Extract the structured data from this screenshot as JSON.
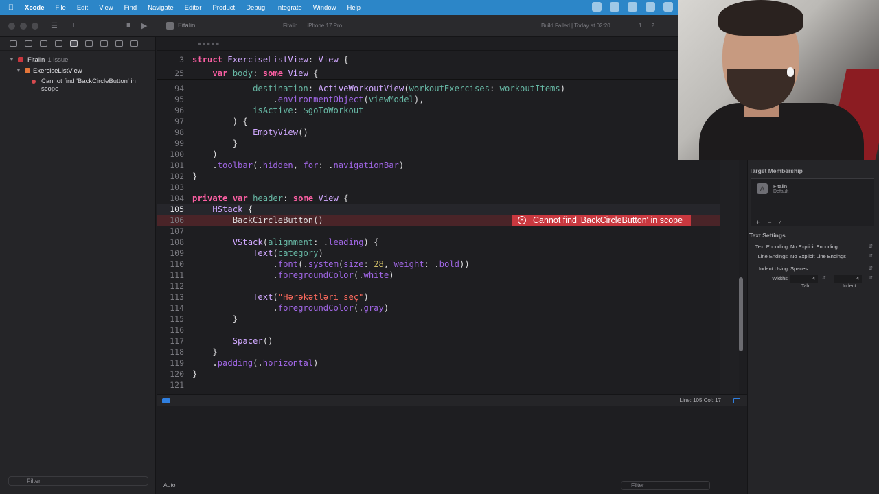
{
  "menubar": {
    "app_name": "Xcode",
    "items": [
      "File",
      "Edit",
      "View",
      "Find",
      "Navigate",
      "Editor",
      "Product",
      "Debug",
      "Integrate",
      "Window",
      "Help"
    ]
  },
  "toolbar": {
    "project": "Fitalin",
    "scheme": "Fitalin",
    "device": "iPhone 17 Pro",
    "build_status": "Build Failed | Today at 02:20",
    "error_count": "1",
    "warning_count": "2"
  },
  "navigator": {
    "project_name": "Fitalin",
    "project_issue_count": "1 issue",
    "file_name": "ExerciseListView",
    "issue_text": "Cannot find 'BackCircleButton' in scope",
    "filter_placeholder": "Filter"
  },
  "editor": {
    "sticky": [
      {
        "num": "3",
        "text": "struct ExerciseListView: View {"
      },
      {
        "num": "25",
        "text": "var body: some View {"
      }
    ],
    "error_message": "Cannot find 'BackCircleButton' in scope",
    "cursor": "Line: 105  Col: 17",
    "console_mode": "Auto",
    "console_filter_placeholder": "Filter"
  },
  "inspector": {
    "target_membership_title": "Target Membership",
    "target_name": "Fitalin",
    "target_sub": "Default",
    "text_settings_title": "Text Settings",
    "text_encoding_label": "Text Encoding",
    "text_encoding_value": "No Explicit Encoding",
    "line_endings_label": "Line Endings",
    "line_endings_value": "No Explicit Line Endings",
    "indent_using_label": "Indent Using",
    "indent_using_value": "Spaces",
    "widths_label": "Widths",
    "tab_width": "4",
    "indent_width": "4",
    "tab_label": "Tab",
    "indent_label": "Indent"
  },
  "colors": {
    "accent": "#2c86c8",
    "error": "#c9383f",
    "keyword": "#fc5fa3",
    "type": "#d0a8ff",
    "string": "#fc6a5d",
    "number": "#d0bf69"
  }
}
